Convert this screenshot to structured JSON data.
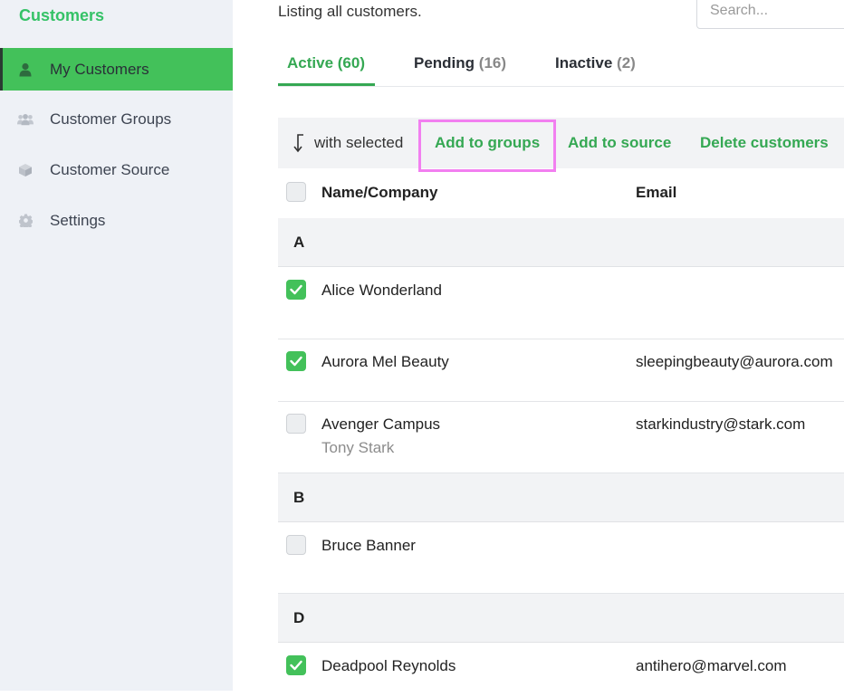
{
  "sidebar": {
    "title": "Customers",
    "items": [
      {
        "label": "My Customers",
        "icon": "user-icon",
        "active": true
      },
      {
        "label": "Customer Groups",
        "icon": "users-icon",
        "active": false
      },
      {
        "label": "Customer Source",
        "icon": "cube-icon",
        "active": false
      },
      {
        "label": "Settings",
        "icon": "gear-icon",
        "active": false
      }
    ]
  },
  "main": {
    "subtitle": "Listing all customers.",
    "search_placeholder": "Search...",
    "tabs": [
      {
        "label": "Active",
        "count": "(60)",
        "active": true
      },
      {
        "label": "Pending",
        "count": "(16)",
        "active": false
      },
      {
        "label": "Inactive",
        "count": "(2)",
        "active": false
      }
    ],
    "bulk": {
      "label": "with selected",
      "actions": [
        "Add to groups",
        "Add to source",
        "Delete customers"
      ]
    },
    "table": {
      "headers": {
        "name": "Name/Company",
        "email": "Email"
      },
      "groups": [
        {
          "letter": "A",
          "rows": [
            {
              "name": "Alice Wonderland",
              "contact": "",
              "email": "",
              "checked": true
            },
            {
              "name": "Aurora Mel Beauty",
              "contact": "",
              "email": "sleepingbeauty@aurora.com",
              "checked": true
            },
            {
              "name": "Avenger Campus",
              "contact": "Tony Stark",
              "email": "starkindustry@stark.com",
              "checked": false
            }
          ]
        },
        {
          "letter": "B",
          "rows": [
            {
              "name": "Bruce Banner",
              "contact": "",
              "email": "",
              "checked": false
            }
          ]
        },
        {
          "letter": "D",
          "rows": [
            {
              "name": "Deadpool Reynolds",
              "contact": "",
              "email": "antihero@marvel.com",
              "checked": true
            }
          ]
        }
      ]
    }
  },
  "colors": {
    "accent": "#35a853",
    "active_nav": "#43c15a",
    "highlight": "#f27ff0"
  }
}
